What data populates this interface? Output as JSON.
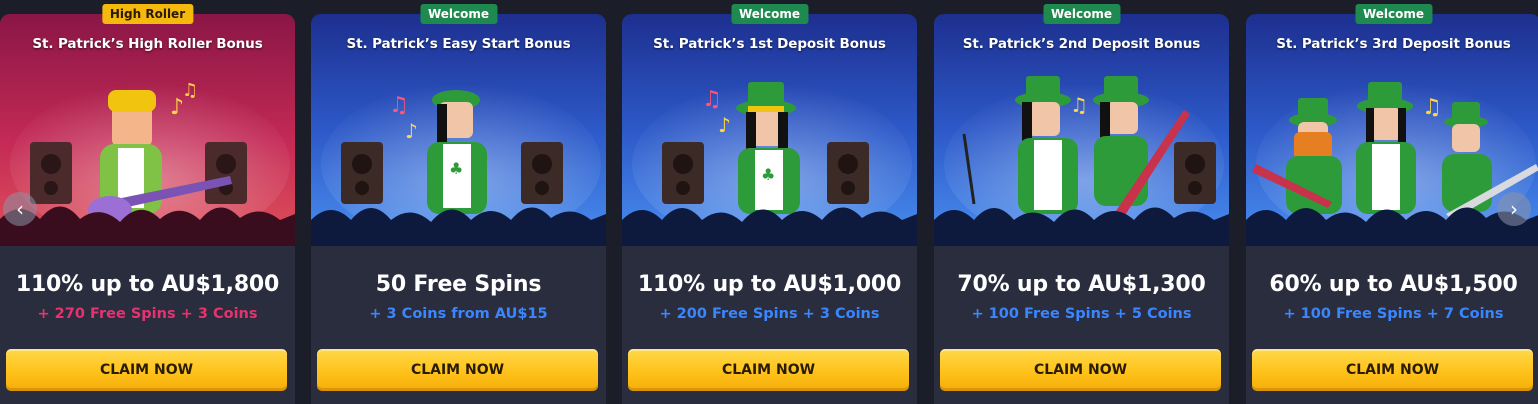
{
  "colors": {
    "pink_accent": "#e5336f",
    "blue_accent": "#3a86ff",
    "claim_yellow": "#ffc21a",
    "welcome_green": "#1e8a4f",
    "roller_gold": "#f5b90d"
  },
  "nav": {
    "prev_icon": "chevron-left-icon",
    "next_icon": "chevron-right-icon",
    "prev_glyph": "‹",
    "next_glyph": "›"
  },
  "cards": [
    {
      "badge": "High Roller",
      "title": "St. Patrick’s High Roller Bonus",
      "headline": "110% up to AU$1,800",
      "subline": "+ 270 Free Spins + 3 Coins",
      "cta": "CLAIM NOW"
    },
    {
      "badge": "Welcome",
      "title": "St. Patrick’s Easy Start Bonus",
      "headline": "50 Free Spins",
      "subline": "+ 3 Coins from AU$15",
      "cta": "CLAIM NOW"
    },
    {
      "badge": "Welcome",
      "title": "St. Patrick’s 1st Deposit Bonus",
      "headline": "110% up to AU$1,000",
      "subline": "+ 200 Free Spins + 3 Coins",
      "cta": "CLAIM NOW"
    },
    {
      "badge": "Welcome",
      "title": "St. Patrick’s 2nd Deposit Bonus",
      "headline": "70% up to AU$1,300",
      "subline": "+ 100 Free Spins + 5 Coins",
      "cta": "CLAIM NOW"
    },
    {
      "badge": "Welcome",
      "title": "St. Patrick’s 3rd Deposit Bonus",
      "headline": "60% up to AU$1,500",
      "subline": "+ 100 Free Spins + 7 Coins",
      "cta": "CLAIM NOW"
    }
  ]
}
